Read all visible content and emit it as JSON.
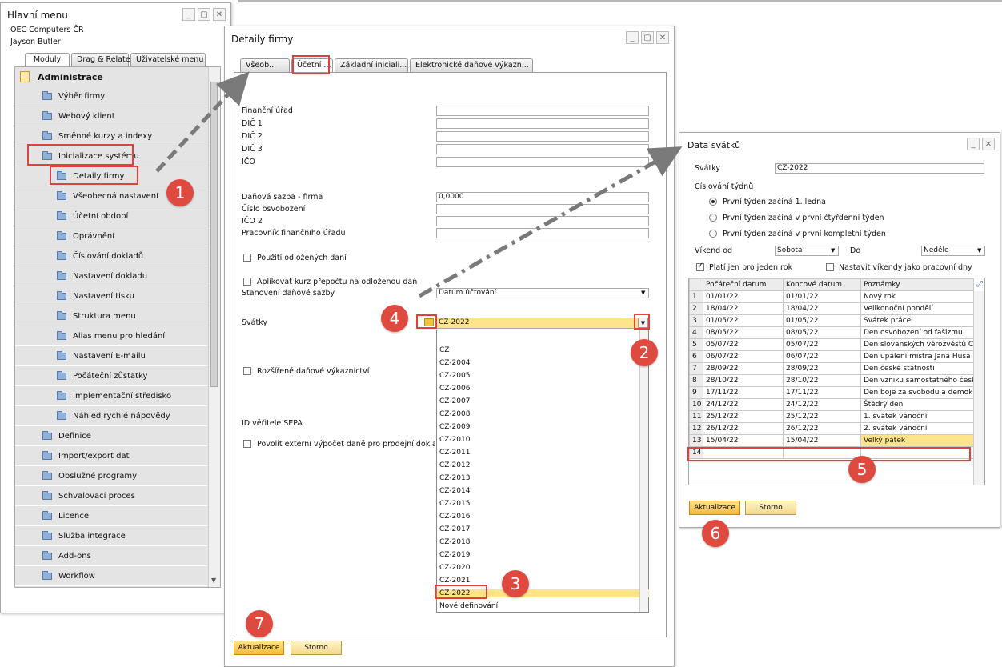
{
  "main_menu": {
    "title": "Hlavní menu",
    "company": "OEC Computers ČR",
    "user": "Jayson Butler",
    "tabs": [
      "Moduly",
      "Drag & Relate",
      "Uživatelské menu"
    ],
    "section": "Administrace",
    "items": [
      "Výběr firmy",
      "Webový klient",
      "Směnné kurzy a indexy",
      "Inicializace systému"
    ],
    "sub_items": [
      "Detaily firmy",
      "Všeobecná nastavení",
      "Účetní období",
      "Oprávnění",
      "Číslování dokladů",
      "Nastavení dokladu",
      "Nastavení tisku",
      "Struktura menu",
      "Alias menu pro hledání",
      "Nastavení E-mailu",
      "Počáteční zůstatky",
      "Implementační středisko",
      "Náhled rychlé nápovědy"
    ],
    "modules": [
      "Definice",
      "Import/export dat",
      "Obslužné programy",
      "Schvalovací proces",
      "Licence",
      "Služba integrace",
      "Add-ons",
      "Workflow"
    ]
  },
  "company_details": {
    "title": "Detaily firmy",
    "tabs": [
      "Všeob...",
      "Účetní ...",
      "Základní iniciali...",
      "Elektronické daňové výkazn..."
    ],
    "fields_a": [
      "Finanční úřad",
      "DIČ 1",
      "DIČ 2",
      "DIČ 3",
      "IČO"
    ],
    "fields_b": [
      "Daňová sazba - firma",
      "Číslo osvobození",
      "IČO 2",
      "Pracovník finančního úřadu"
    ],
    "tax_rate_value": "0,0000",
    "chk_deferred": "Použití odložených daní",
    "chk_apply_rate": "Aplikovat kurz přepočtu na odloženou daň",
    "rate_label": "Stanovení daňové sazby",
    "rate_value": "Datum účtování",
    "holidays_label": "Svátky",
    "holidays_value": "CZ-2022",
    "chk_extended": "Rozšířené daňové výkaznictví",
    "sepa_label": "ID věřitele SEPA",
    "chk_external": "Povolit externí výpočet daně pro prodejní doklady",
    "dropdown_options": [
      "CZ",
      "CZ-2004",
      "CZ-2005",
      "CZ-2006",
      "CZ-2007",
      "CZ-2008",
      "CZ-2009",
      "CZ-2010",
      "CZ-2011",
      "CZ-2012",
      "CZ-2013",
      "CZ-2014",
      "CZ-2015",
      "CZ-2016",
      "CZ-2017",
      "CZ-2018",
      "CZ-2019",
      "CZ-2020",
      "CZ-2021",
      "CZ-2022",
      "Nové definování"
    ],
    "ok_button": "Aktualizace",
    "cancel_button": "Storno"
  },
  "holidays_window": {
    "title": "Data svátků",
    "svatky_label": "Svátky",
    "svatky_value": "CZ-2022",
    "week_numbering": "Číslování týdnů",
    "radio_options": [
      "První týden začíná 1. ledna",
      "První týden začíná v první čtyřdenní týden",
      "První týden začíná v první kompletní týden"
    ],
    "weekend_from_label": "Víkend od",
    "weekend_from_value": "Sobota",
    "to_label": "Do",
    "to_value": "Neděle",
    "chk_one_year": "Platí jen pro jeden rok",
    "chk_workdays": "Nastavit víkendy jako pracovní dny",
    "columns": [
      "Počáteční datum",
      "Koncové datum",
      "Poznámky"
    ],
    "rows": [
      [
        "1",
        "01/01/22",
        "01/01/22",
        "Nový rok"
      ],
      [
        "2",
        "18/04/22",
        "18/04/22",
        "Velikonoční pondělí"
      ],
      [
        "3",
        "01/05/22",
        "01/05/22",
        "Svátek práce"
      ],
      [
        "4",
        "08/05/22",
        "08/05/22",
        "Den osvobození od fašizmu"
      ],
      [
        "5",
        "05/07/22",
        "05/07/22",
        "Den slovanských věrozvěstů C"
      ],
      [
        "6",
        "06/07/22",
        "06/07/22",
        "Den upálení mistra Jana Husa"
      ],
      [
        "7",
        "28/09/22",
        "28/09/22",
        "Den české státnosti"
      ],
      [
        "8",
        "28/10/22",
        "28/10/22",
        "Den vzniku samostatného česk"
      ],
      [
        "9",
        "17/11/22",
        "17/11/22",
        "Den boje za svobodu a demok"
      ],
      [
        "10",
        "24/12/22",
        "24/12/22",
        "Štědrý den"
      ],
      [
        "11",
        "25/12/22",
        "25/12/22",
        "1. svátek vánoční"
      ],
      [
        "12",
        "26/12/22",
        "26/12/22",
        "2. svátek vánoční"
      ],
      [
        "13",
        "15/04/22",
        "15/04/22",
        "Velký pátek"
      ],
      [
        "14",
        "",
        "",
        ""
      ]
    ],
    "ok_button": "Aktualizace",
    "cancel_button": "Storno"
  },
  "markers": [
    "1",
    "2",
    "3",
    "4",
    "5",
    "6",
    "7"
  ]
}
